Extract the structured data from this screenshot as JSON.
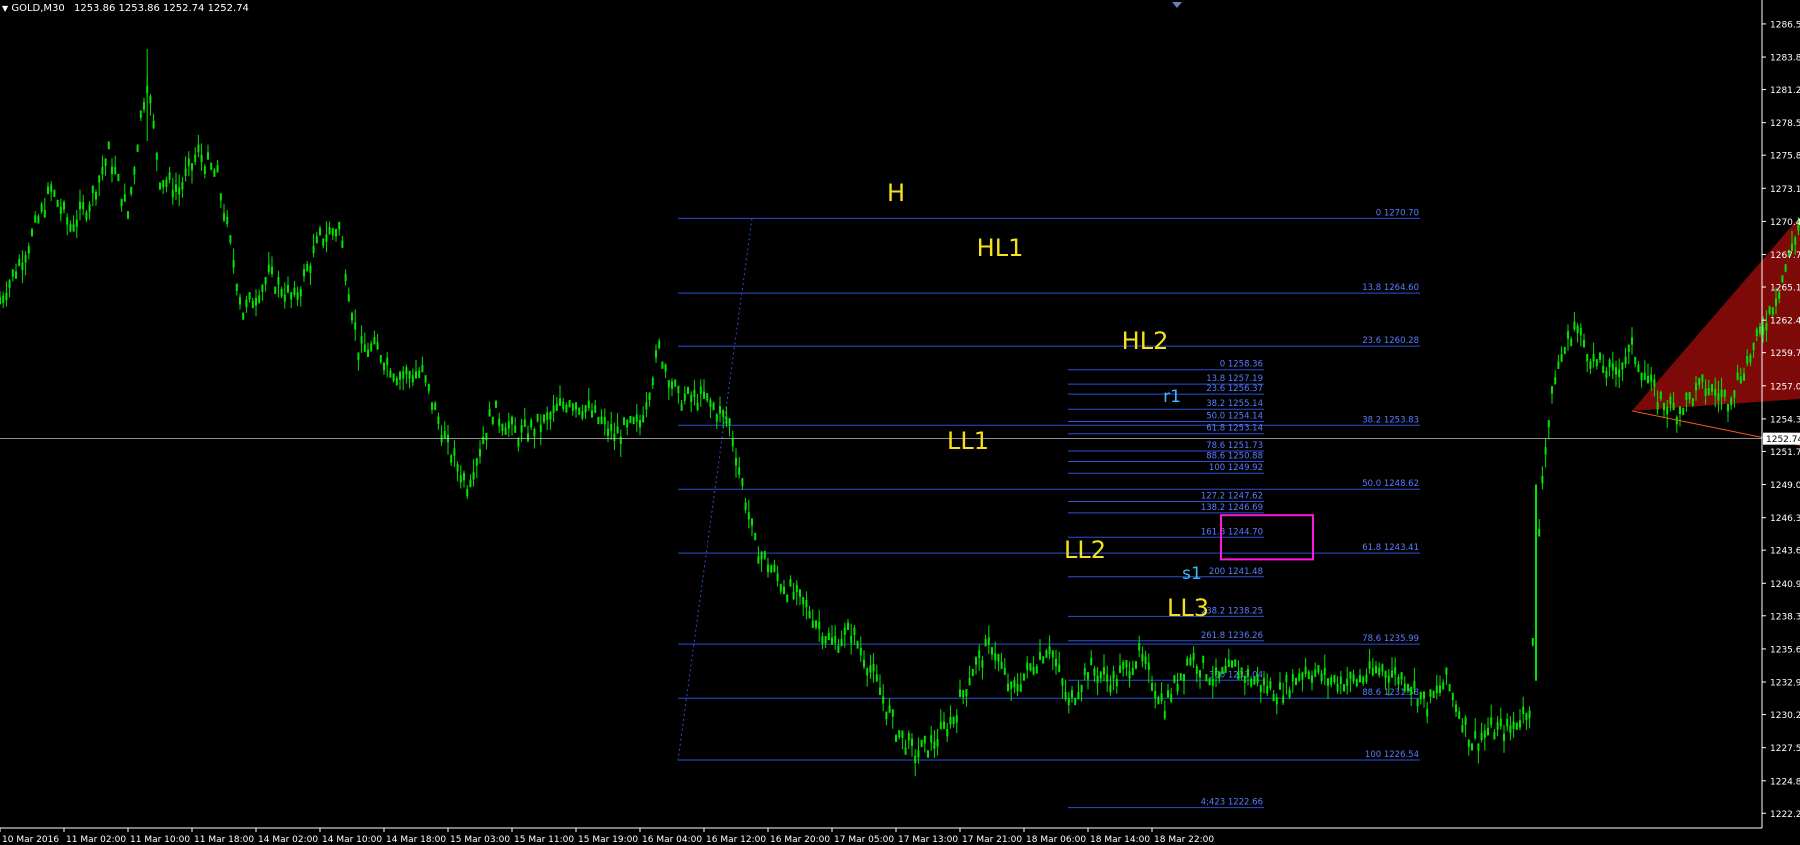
{
  "header": {
    "arrow": "▼",
    "symbol": "GOLD,M30",
    "ohlc": "1253.86 1253.86 1252.74 1252.74"
  },
  "colors": {
    "background": "#000000",
    "candle": "#00e600",
    "axis": "#ffffff",
    "fib": "#2b4fd6",
    "fib_text": "#5a7dff",
    "pattern_red": "#8b0a0a",
    "pattern_blue": "#0b1ef0",
    "magenta": "#ff1ad9",
    "orange": "#ff5a1f",
    "label_yellow": "#f6e21c",
    "label_cyan": "#3fb7ff"
  },
  "chart_data": {
    "type": "candlestick",
    "symbol": "GOLD",
    "timeframe": "M30",
    "ylim": [
      1221.0,
      1288.5
    ],
    "current_price": "1252.74",
    "y_ticks": [
      "1286.55",
      "1283.85",
      "1281.20",
      "1278.50",
      "1275.85",
      "1273.15",
      "1270.45",
      "1267.75",
      "1265.10",
      "1262.40",
      "1259.75",
      "1257.05",
      "1254.35",
      "1251.70",
      "1249.00",
      "1246.30",
      "1243.65",
      "1240.95",
      "1238.30",
      "1235.60",
      "1232.90",
      "1230.25",
      "1227.55",
      "1224.85",
      "1222.20"
    ],
    "x_ticks": [
      "10 Mar 2016",
      "11 Mar 02:00",
      "11 Mar 10:00",
      "11 Mar 18:00",
      "14 Mar 02:00",
      "14 Mar 10:00",
      "14 Mar 18:00",
      "15 Mar 03:00",
      "15 Mar 11:00",
      "15 Mar 19:00",
      "16 Mar 04:00",
      "16 Mar 12:00",
      "16 Mar 20:00",
      "17 Mar 05:00",
      "17 Mar 13:00",
      "17 Mar 21:00",
      "18 Mar 06:00",
      "18 Mar 14:00",
      "18 Mar 22:00"
    ],
    "price_path": [
      [
        0,
        1264
      ],
      [
        0.4,
        1268
      ],
      [
        0.8,
        1273
      ],
      [
        1.1,
        1270
      ],
      [
        1.4,
        1272
      ],
      [
        1.7,
        1276
      ],
      [
        2.0,
        1271
      ],
      [
        2.2,
        1279
      ],
      [
        2.3,
        1282
      ],
      [
        2.5,
        1274
      ],
      [
        2.8,
        1273
      ],
      [
        3.1,
        1276
      ],
      [
        3.4,
        1274
      ],
      [
        3.8,
        1263
      ],
      [
        4.2,
        1266
      ],
      [
        4.6,
        1264
      ],
      [
        5.0,
        1269
      ],
      [
        5.3,
        1270
      ],
      [
        5.6,
        1260
      ],
      [
        5.9,
        1260
      ],
      [
        6.2,
        1258
      ],
      [
        6.6,
        1258
      ],
      [
        7.0,
        1252
      ],
      [
        7.3,
        1249
      ],
      [
        7.7,
        1255
      ],
      [
        8.1,
        1253
      ],
      [
        8.5,
        1254
      ],
      [
        8.9,
        1256
      ],
      [
        9.2,
        1255
      ],
      [
        9.6,
        1253
      ],
      [
        10.0,
        1254
      ],
      [
        10.3,
        1260
      ],
      [
        10.6,
        1256
      ],
      [
        11.0,
        1256
      ],
      [
        11.4,
        1254
      ],
      [
        11.8,
        1244
      ],
      [
        12.2,
        1241
      ],
      [
        12.6,
        1239
      ],
      [
        13.0,
        1236
      ],
      [
        13.3,
        1237
      ],
      [
        13.6,
        1234
      ],
      [
        14.0,
        1229
      ],
      [
        14.3,
        1227
      ],
      [
        14.6,
        1228
      ],
      [
        14.9,
        1230
      ],
      [
        15.2,
        1234
      ],
      [
        15.5,
        1236
      ],
      [
        15.8,
        1232
      ],
      [
        16.1,
        1234
      ],
      [
        16.4,
        1236
      ],
      [
        16.7,
        1231
      ],
      [
        17.0,
        1234
      ],
      [
        17.4,
        1233
      ],
      [
        17.8,
        1235
      ],
      [
        18.2,
        1231
      ],
      [
        18.6,
        1235
      ],
      [
        19.0,
        1233
      ],
      [
        19.3,
        1234
      ],
      [
        19.6,
        1233
      ],
      [
        20.0,
        1232
      ],
      [
        20.4,
        1234
      ],
      [
        20.8,
        1233
      ],
      [
        21.2,
        1233
      ],
      [
        21.6,
        1234
      ],
      [
        22.0,
        1233
      ],
      [
        22.3,
        1231
      ],
      [
        22.6,
        1233
      ],
      [
        23.0,
        1228
      ],
      [
        23.3,
        1229
      ],
      [
        23.6,
        1229
      ],
      [
        23.9,
        1231
      ],
      [
        24.1,
        1250
      ],
      [
        24.3,
        1258
      ],
      [
        24.6,
        1262
      ],
      [
        24.9,
        1259
      ],
      [
        25.2,
        1258
      ],
      [
        25.5,
        1260
      ],
      [
        25.9,
        1256
      ],
      [
        26.2,
        1255
      ],
      [
        26.6,
        1257
      ],
      [
        27.0,
        1256
      ],
      [
        27.4,
        1260
      ],
      [
        27.8,
        1265
      ],
      [
        28.1,
        1270
      ],
      [
        28.3,
        1268
      ],
      [
        28.6,
        1266
      ],
      [
        29.0,
        1264
      ],
      [
        29.4,
        1265
      ],
      [
        29.8,
        1263
      ],
      [
        30.2,
        1262
      ],
      [
        30.5,
        1256
      ],
      [
        30.8,
        1257
      ],
      [
        31.1,
        1259
      ],
      [
        31.4,
        1262
      ],
      [
        31.7,
        1266
      ],
      [
        32.0,
        1265
      ],
      [
        32.4,
        1263
      ],
      [
        32.8,
        1262
      ],
      [
        33.2,
        1263
      ],
      [
        33.5,
        1260
      ],
      [
        33.8,
        1256
      ],
      [
        34.1,
        1254
      ],
      [
        34.4,
        1250
      ],
      [
        34.6,
        1248
      ],
      [
        34.9,
        1251
      ],
      [
        35.2,
        1254
      ],
      [
        35.5,
        1255
      ],
      [
        35.8,
        1258
      ],
      [
        36.0,
        1256
      ],
      [
        36.3,
        1254
      ],
      [
        36.6,
        1256
      ],
      [
        36.9,
        1255
      ],
      [
        37.2,
        1256
      ],
      [
        37.5,
        1254
      ],
      [
        37.7,
        1253
      ]
    ],
    "fib_levels_left": [
      {
        "label": "0 1270.70",
        "price": 1270.7
      },
      {
        "label": "13.8 1264.60",
        "price": 1264.6
      },
      {
        "label": "23.6 1260.28",
        "price": 1260.28
      },
      {
        "label": "38.2 1253.83",
        "price": 1253.83
      },
      {
        "label": "50.0 1248.62",
        "price": 1248.62
      },
      {
        "label": "61.8 1243.41",
        "price": 1243.41
      },
      {
        "label": "78.6 1235.99",
        "price": 1235.99
      },
      {
        "label": "88.6 1231.58",
        "price": 1231.58
      },
      {
        "label": "100 1226.54",
        "price": 1226.54
      }
    ],
    "fib_levels_right": [
      {
        "label": "0 1258.36",
        "price": 1258.36
      },
      {
        "label": "13.8 1257.19",
        "price": 1257.19
      },
      {
        "label": "23.6 1256.37",
        "price": 1256.37
      },
      {
        "label": "38.2 1255.14",
        "price": 1255.14
      },
      {
        "label": "50.0 1254.14",
        "price": 1254.14
      },
      {
        "label": "61.8 1253.14",
        "price": 1253.14
      },
      {
        "label": "78.6 1251.73",
        "price": 1251.73
      },
      {
        "label": "88.6 1250.88",
        "price": 1250.88
      },
      {
        "label": "100 1249.92",
        "price": 1249.92
      },
      {
        "label": "127.2 1247.62",
        "price": 1247.62
      },
      {
        "label": "138.2 1246.69",
        "price": 1246.69
      },
      {
        "label": "161.8 1244.70",
        "price": 1244.7
      },
      {
        "label": "200 1241.48",
        "price": 1241.48
      },
      {
        "label": "238.2 1238.25",
        "price": 1238.25
      },
      {
        "label": "261.8 1236.26",
        "price": 1236.26
      },
      {
        "label": "300 1233.04",
        "price": 1233.04
      },
      {
        "label": "4;423 1222.66",
        "price": 1222.66
      }
    ],
    "annotations": [
      {
        "text": "H",
        "color": "yellow"
      },
      {
        "text": "HL1",
        "color": "yellow"
      },
      {
        "text": "HL2",
        "color": "yellow"
      },
      {
        "text": "LL1",
        "color": "yellow"
      },
      {
        "text": "LL2",
        "color": "yellow"
      },
      {
        "text": "LL3",
        "color": "yellow"
      },
      {
        "text": "r1",
        "color": "cyan"
      },
      {
        "text": "s1",
        "color": "cyan"
      }
    ]
  }
}
